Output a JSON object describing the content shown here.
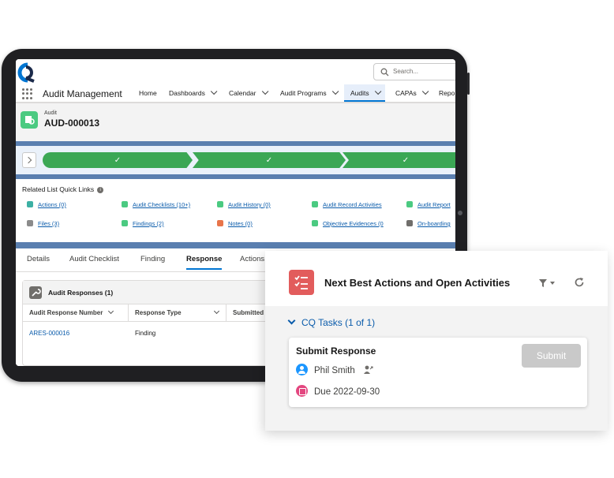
{
  "app": {
    "name": "Audit Management",
    "search_placeholder": "Search..."
  },
  "nav": {
    "items": [
      {
        "label": "Home",
        "chevron": false
      },
      {
        "label": "Dashboards",
        "chevron": true
      },
      {
        "label": "Calendar",
        "chevron": true
      },
      {
        "label": "Audit Programs",
        "chevron": true
      },
      {
        "label": "Audits",
        "chevron": true,
        "active": true
      },
      {
        "label": "CAPAs",
        "chevron": true
      },
      {
        "label": "Repo",
        "chevron": false
      }
    ]
  },
  "record": {
    "object_label": "Audit",
    "name": "AUD-000013"
  },
  "path": {
    "stage_marks": [
      "✓",
      "✓",
      "✓"
    ],
    "completed_color": "#3ba755"
  },
  "quick_links": {
    "title": "Related List Quick Links",
    "links": [
      {
        "label": "Actions (0)",
        "color": "#3cb0a4"
      },
      {
        "label": "Audit Checklists (10+)",
        "color": "#4bca81"
      },
      {
        "label": "Audit History (0)",
        "color": "#4bca81"
      },
      {
        "label": "Audit Record Activities",
        "color": "#4bca81"
      },
      {
        "label": "Audit Report",
        "color": "#4bca81"
      },
      {
        "label": "Files (3)",
        "color": "#8b8b8b"
      },
      {
        "label": "Findings (2)",
        "color": "#4bca81"
      },
      {
        "label": "Notes (0)",
        "color": "#e8754a"
      },
      {
        "label": "Objective Evidences (0",
        "color": "#4bca81"
      },
      {
        "label": "On-boarding",
        "color": "#706e6b"
      }
    ]
  },
  "tabs": [
    "Details",
    "Audit Checklist",
    "Finding",
    "Response",
    "Actions"
  ],
  "active_tab": "Response",
  "responses": {
    "title": "Audit Responses (1)",
    "columns": [
      "Audit Response Number",
      "Response Type",
      "Submitted C"
    ],
    "rows": [
      {
        "number": "ARES-000016",
        "type": "Finding"
      }
    ]
  },
  "nba_panel": {
    "title": "Next Best Actions and Open Activities",
    "section": "CQ Tasks (1 of 1)",
    "task": {
      "title": "Submit Response",
      "assignee": "Phil Smith",
      "due": "Due 2022-09-30",
      "button": "Submit"
    },
    "icon_color": "#e25c5c"
  }
}
